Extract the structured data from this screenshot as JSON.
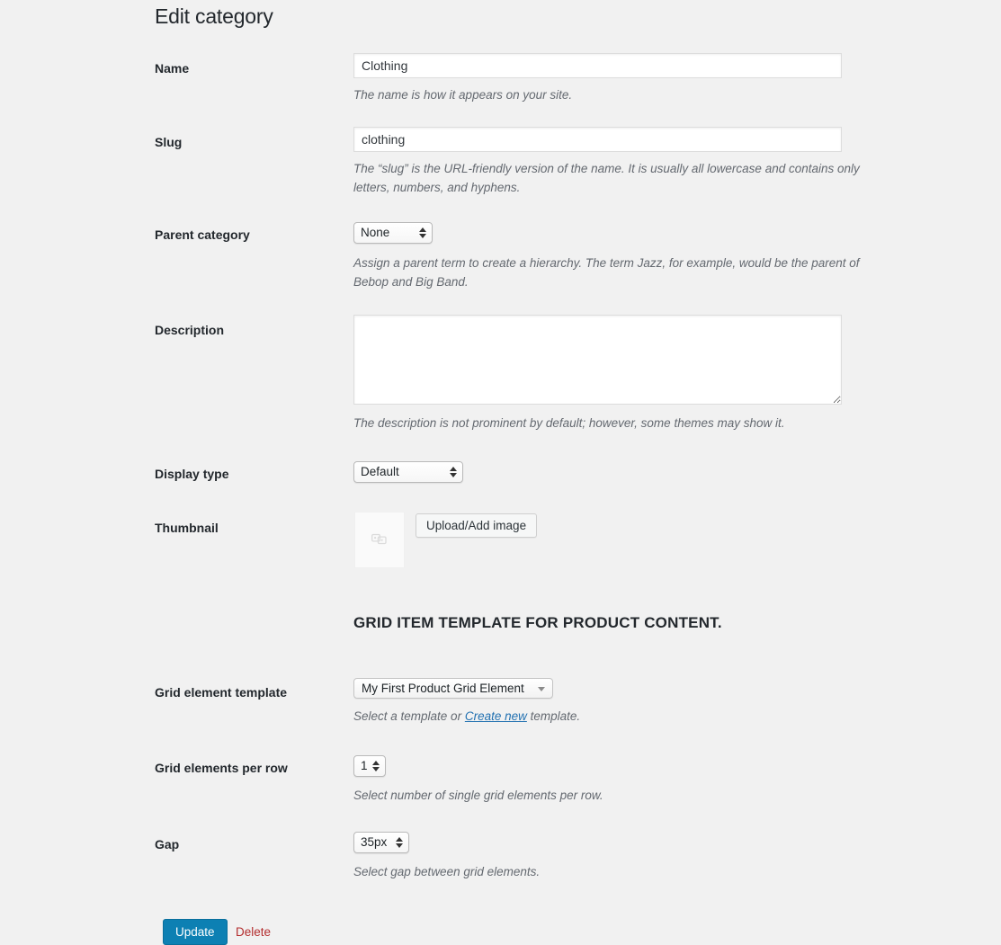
{
  "page": {
    "title": "Edit category",
    "section_heading": "Grid item template for product content."
  },
  "fields": {
    "name": {
      "label": "Name",
      "value": "Clothing",
      "placeholder": "",
      "description": "The name is how it appears on your site."
    },
    "slug": {
      "label": "Slug",
      "value": "clothing",
      "placeholder": "",
      "description": "The “slug” is the URL-friendly version of the name. It is usually all lowercase and contains only letters, numbers, and hyphens."
    },
    "parent_category": {
      "label": "Parent category",
      "value": "None",
      "description": "Assign a parent term to create a hierarchy. The term Jazz, for example, would be the parent of Bebop and Big Band."
    },
    "description": {
      "label": "Description",
      "value": "",
      "placeholder": "",
      "description": "The description is not prominent by default; however, some themes may show it."
    },
    "display_type": {
      "label": "Display type",
      "value": "Default"
    },
    "thumbnail": {
      "label": "Thumbnail",
      "upload_button": "Upload/Add image",
      "placeholder_icon": "broken-image-icon"
    },
    "grid_element_template": {
      "label": "Grid element template",
      "value": "My First Product Grid Element",
      "description_prefix": "Select a template or ",
      "link_text": "Create new",
      "description_suffix": " template."
    },
    "grid_elements_per_row": {
      "label": "Grid elements per row",
      "value": "1",
      "description": "Select number of single grid elements per row."
    },
    "gap": {
      "label": "Gap",
      "value": "35px",
      "description": "Select gap between grid elements."
    }
  },
  "actions": {
    "update_label": "Update",
    "delete_label": "Delete"
  },
  "colors": {
    "background": "#f1f1f1",
    "primary_button": "#0d80b3",
    "delete_link": "#b32d2e",
    "link": "#2271b1",
    "heading_text": "#23282d",
    "description_text": "#646970"
  }
}
